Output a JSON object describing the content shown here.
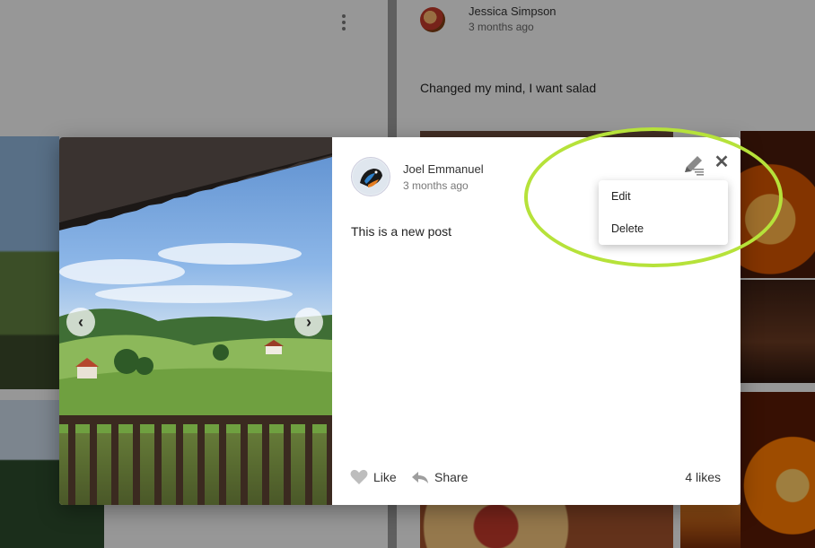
{
  "background": {
    "post_author": "Jessica Simpson",
    "post_time": "3 months ago",
    "post_text": "Changed my mind, I want salad"
  },
  "modal": {
    "author": "Joel Emmanuel",
    "time": "3 months ago",
    "text": "This is a new post",
    "prev_label": "‹",
    "next_label": "›",
    "close_label": "✕",
    "menu": {
      "edit_label": "Edit",
      "delete_label": "Delete"
    },
    "actions": {
      "like_label": "Like",
      "share_label": "Share",
      "likes_count": "4 likes"
    }
  },
  "colors": {
    "highlight": "#b6e23a",
    "overlay": "rgba(0,0,0,0.38)"
  },
  "icons": {
    "more": "more-vertical-icon",
    "edit": "pencil-icon",
    "close": "close-icon",
    "like": "heart-icon",
    "share": "share-arrow-icon"
  }
}
